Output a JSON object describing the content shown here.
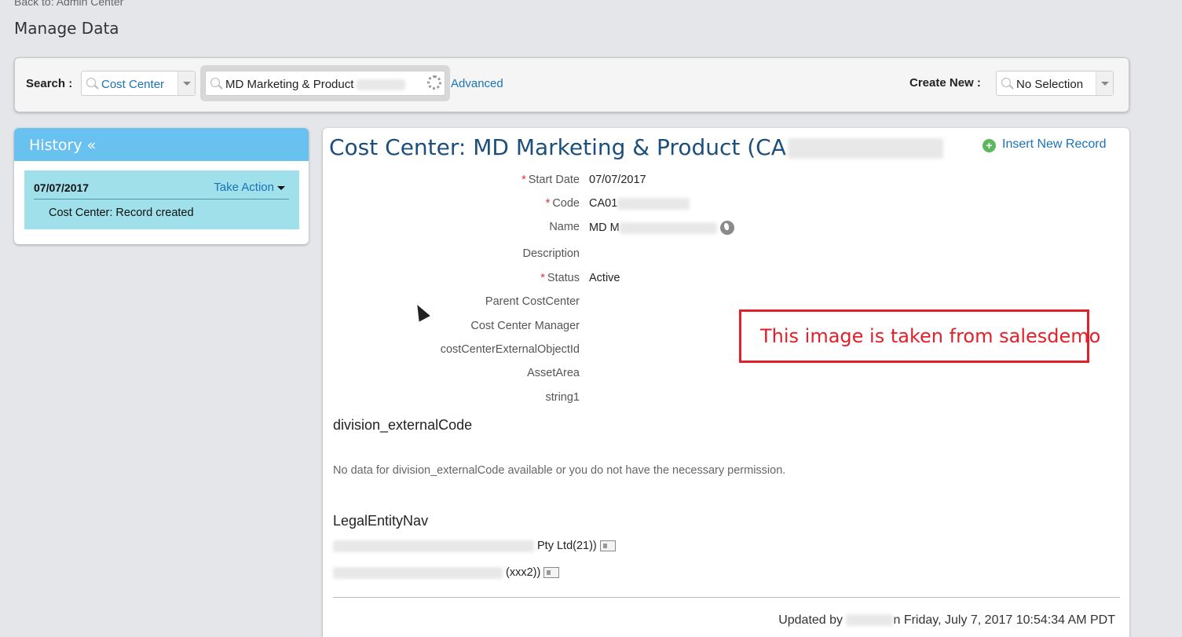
{
  "header": {
    "back_link": "Back to: Admin Center",
    "title": "Manage Data"
  },
  "search": {
    "label": "Search :",
    "type_value": "Cost Center",
    "entity_value": "MD Marketing & Product",
    "advanced_label": "Advanced",
    "create_label": "Create New :",
    "create_value": "No Selection"
  },
  "history": {
    "title": "History «",
    "items": [
      {
        "date": "07/07/2017",
        "action_label": "Take Action",
        "description": "Cost Center: Record created"
      }
    ]
  },
  "record": {
    "title": "Cost Center: MD Marketing & Product (CA",
    "insert_label": "Insert New Record",
    "fields": [
      {
        "label": "Start Date",
        "required": "*",
        "value": "07/07/2017"
      },
      {
        "label": "Code",
        "required": "*",
        "value": "CA01"
      },
      {
        "label": "Name",
        "value": "MD M"
      },
      {
        "label": "Description",
        "value": ""
      },
      {
        "label": "Status",
        "required": "*",
        "value": "Active"
      },
      {
        "label": "Parent CostCenter",
        "value": ""
      },
      {
        "label": "Cost Center Manager",
        "value": ""
      },
      {
        "label": "costCenterExternalObjectId",
        "value": ""
      },
      {
        "label": "AssetArea",
        "value": ""
      },
      {
        "label": "string1",
        "value": ""
      }
    ],
    "division_heading": "division_externalCode",
    "division_no_data": "No data for division_externalCode available or you do not have the necessary permission.",
    "legal_heading": "LegalEntityNav",
    "legal_rows": [
      {
        "value": "Pty Ltd(21))"
      },
      {
        "value": "(xxx2))"
      }
    ],
    "updated_prefix": "Updated by",
    "updated_suffix": "n Friday, July 7, 2017 10:54:34 AM PDT"
  },
  "annotation": {
    "text": "This image is taken from salesdemo"
  },
  "icons": {
    "insert": "plus-circle-icon",
    "name_translate": "globe-icon",
    "legal_details": "card-icon",
    "loading": "spinner-icon"
  },
  "colors": {
    "link": "#1a73b8",
    "history_header": "#69c1f0",
    "history_item": "#9fe0ea",
    "title": "#1c4f7c",
    "required": "#d33333",
    "annotation": "#e3202a"
  }
}
